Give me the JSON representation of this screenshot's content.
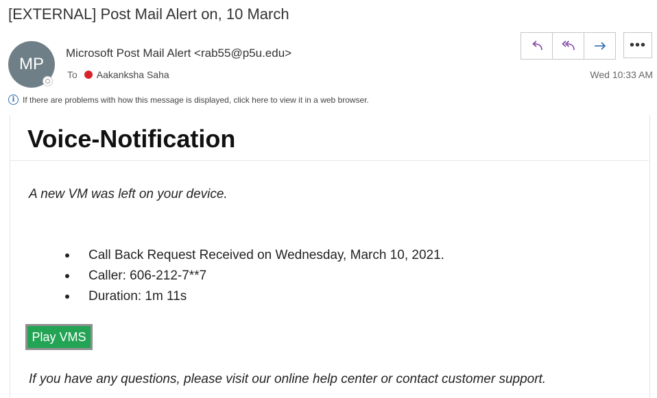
{
  "email": {
    "subject": "[EXTERNAL] Post Mail Alert on, 10 March",
    "sender": {
      "initials": "MP",
      "display": "Microsoft Post Mail Alert <rab55@p5u.edu>"
    },
    "to_label": "To",
    "recipient": "Aakanksha Saha",
    "timestamp": "Wed 10:33 AM",
    "info_bar": "If there are problems with how this message is displayed, click here to view it in a web browser.",
    "info_icon_glyph": "i",
    "more_glyph": "•••",
    "actions": {
      "reply_icon": "reply-icon",
      "reply_all_icon": "reply-all-icon",
      "forward_icon": "forward-icon",
      "more_icon": "more-icon"
    },
    "accent_color": "#7b3fa0",
    "forward_color": "#2b6cb0",
    "presence_color": "#d9232a"
  },
  "message": {
    "title": "Voice-Notification",
    "lead": "A new VM was left on your device.",
    "bullets": [
      "Call Back Request Received on Wednesday, March 10, 2021.",
      "Caller: 606-212-7**7",
      "Duration: 1m 11s"
    ],
    "play_button": "Play VMS",
    "play_button_color": "#23a455",
    "footer": "If you have any questions, please visit our online help center or contact customer support."
  }
}
